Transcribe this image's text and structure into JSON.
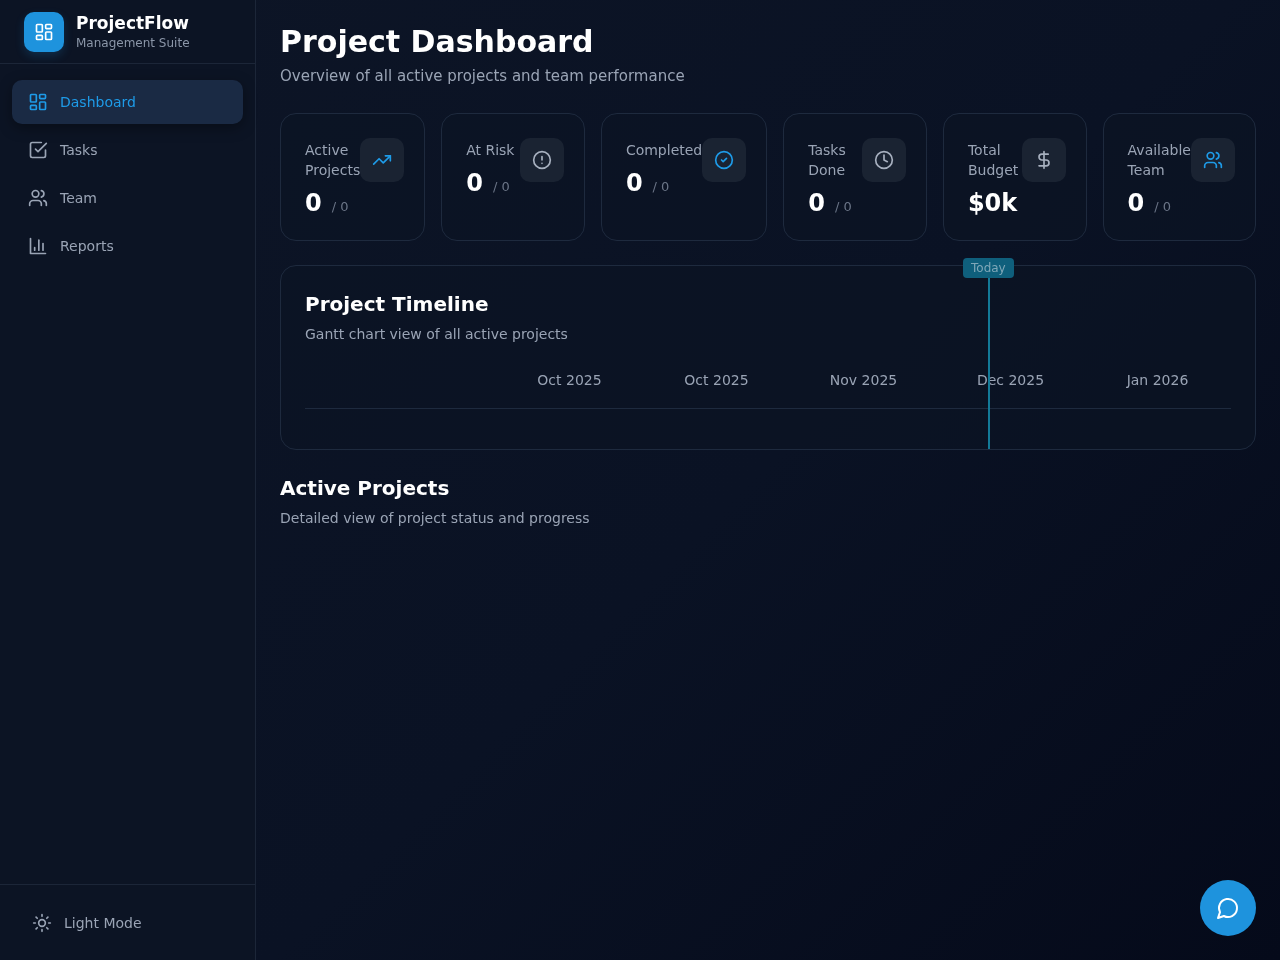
{
  "brand": {
    "name": "ProjectFlow",
    "subtitle": "Management Suite"
  },
  "nav": [
    {
      "label": "Dashboard",
      "kind": "grid",
      "selected": true
    },
    {
      "label": "Tasks",
      "kind": "check",
      "selected": false
    },
    {
      "label": "Team",
      "kind": "users",
      "selected": false
    },
    {
      "label": "Reports",
      "kind": "chart",
      "selected": false
    }
  ],
  "theme_toggle": {
    "label": "Light Mode"
  },
  "page": {
    "title": "Project Dashboard",
    "subtitle": "Overview of all active projects and team performance"
  },
  "stats": [
    {
      "label": "Active Projects",
      "value": "0",
      "total": "/ 0",
      "kind": "trend"
    },
    {
      "label": "At Risk",
      "value": "0",
      "total": "/ 0",
      "kind": "alert"
    },
    {
      "label": "Completed",
      "value": "0",
      "total": "/ 0",
      "kind": "done"
    },
    {
      "label": "Tasks Done",
      "value": "0",
      "total": "/ 0",
      "kind": "clock"
    },
    {
      "label": "Total Budget",
      "value": "$0k",
      "kind": "dollar"
    },
    {
      "label": "Available Team",
      "value": "0",
      "total": "/ 0",
      "kind": "users"
    }
  ],
  "timeline": {
    "title": "Project Timeline",
    "subtitle": "Gantt chart view of all active projects",
    "months": [
      "Oct 2025",
      "Oct 2025",
      "Nov 2025",
      "Dec 2025",
      "Jan 2026"
    ],
    "today_label": "Today"
  },
  "projects": {
    "title": "Active Projects",
    "subtitle": "Detailed view of project status and progress"
  }
}
